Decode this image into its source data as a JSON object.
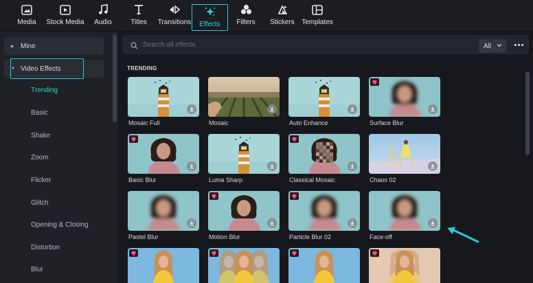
{
  "toolbar": {
    "tabs": [
      {
        "label": "Media",
        "icon": "media-icon"
      },
      {
        "label": "Stock Media",
        "icon": "stock-media-icon"
      },
      {
        "label": "Audio",
        "icon": "music-note-icon"
      },
      {
        "label": "Titles",
        "icon": "text-t-icon"
      },
      {
        "label": "Transitions",
        "icon": "transitions-icon"
      },
      {
        "label": "Effects",
        "icon": "sparkle-effects-icon",
        "active": true
      },
      {
        "label": "Filters",
        "icon": "filters-icon"
      },
      {
        "label": "Stickers",
        "icon": "stickers-icon"
      },
      {
        "label": "Templates",
        "icon": "templates-icon"
      }
    ]
  },
  "sidebar": {
    "mine": "Mine",
    "video_effects": "Video Effects",
    "subcategories": [
      "Trending",
      "Basic",
      "Shake",
      "Zoom",
      "Flicker",
      "Glitch",
      "Opening & Closing",
      "Distortion",
      "Blur"
    ],
    "active_sub": "Trending"
  },
  "search": {
    "placeholder": "Search all effects",
    "filter_value": "All"
  },
  "section": {
    "title": "TRENDING"
  },
  "effects": [
    {
      "name": "Mosaic Full",
      "thumb": "lighthouse",
      "premium": false
    },
    {
      "name": "Mosaic",
      "thumb": "vineyard",
      "premium": false
    },
    {
      "name": "Auto Enhance",
      "thumb": "lighthouse",
      "premium": false
    },
    {
      "name": "Surface Blur",
      "thumb": "portrait-blur",
      "premium": true
    },
    {
      "name": "Basic Blur",
      "thumb": "portrait",
      "premium": true
    },
    {
      "name": "Luma Sharp",
      "thumb": "lighthouse",
      "premium": false
    },
    {
      "name": "Classical Mosaic",
      "thumb": "portrait-mosaic",
      "premium": true
    },
    {
      "name": "Chaos 02",
      "thumb": "dancer",
      "premium": false
    },
    {
      "name": "Pastel Blur",
      "thumb": "portrait-blur",
      "premium": false
    },
    {
      "name": "Motion Blur",
      "thumb": "portrait",
      "premium": true
    },
    {
      "name": "Particle Blur 02",
      "thumb": "portrait-blur",
      "premium": true
    },
    {
      "name": "Face-off",
      "thumb": "portrait-blur",
      "premium": false
    },
    {
      "name": "",
      "thumb": "yellow-dress",
      "premium": true
    },
    {
      "name": "",
      "thumb": "yellow-dress-multi",
      "premium": true
    },
    {
      "name": "",
      "thumb": "yellow-dress",
      "premium": true
    },
    {
      "name": "",
      "thumb": "yellow-dress-streak",
      "premium": true
    }
  ],
  "colors": {
    "accent": "#21d3e0",
    "active_text": "#2fd7c4",
    "background": "#16181d",
    "panel": "#1f2127",
    "premium": "#ff4f86"
  }
}
